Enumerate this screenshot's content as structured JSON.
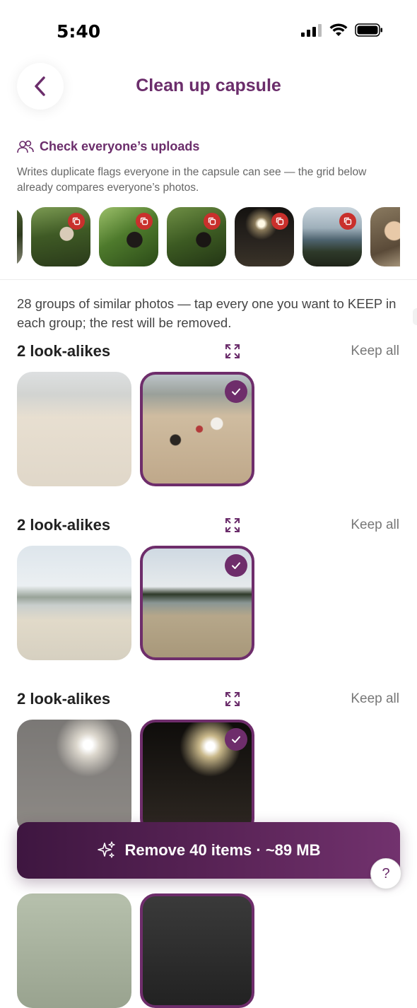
{
  "status_bar": {
    "time": "5:40"
  },
  "header": {
    "title": "Clean up capsule"
  },
  "check_uploads": {
    "label": "Check everyone’s uploads",
    "description": "Writes duplicate flags everyone in the capsule can see — the grid below already compares everyone’s photos."
  },
  "intro_text": "28 groups of similar photos — tap every one you want to KEEP in each group; the rest will be removed.",
  "groups": [
    {
      "title": "2 look-alikes",
      "keep_all": "Keep all"
    },
    {
      "title": "2 look-alikes",
      "keep_all": "Keep all"
    },
    {
      "title": "2 look-alikes",
      "keep_all": "Keep all"
    }
  ],
  "cta": {
    "label": "Remove 40 items · ~89 MB"
  },
  "help": {
    "label": "?"
  },
  "colors": {
    "accent": "#6b2d6b",
    "dup_badge": "#c9302c",
    "cta_start": "#3e1640",
    "cta_end": "#72326e"
  }
}
